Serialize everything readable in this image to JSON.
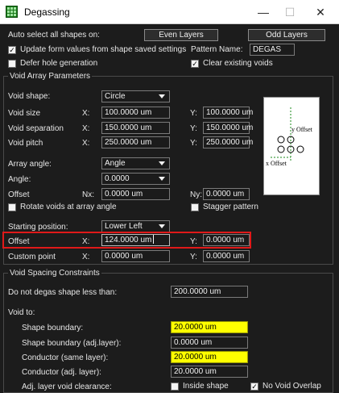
{
  "window": {
    "title": "Degassing",
    "minimize": "—",
    "maximize": "☐",
    "close": "✕"
  },
  "top": {
    "auto_select_label": "Auto select all shapes on:",
    "even_layers": "Even Layers",
    "odd_layers": "Odd Layers",
    "update_form_label": "Update form values from shape saved settings",
    "update_form_checked": true,
    "pattern_name_label": "Pattern Name:",
    "pattern_name_value": "DEGAS",
    "defer_hole_label": "Defer hole generation",
    "defer_hole_checked": false,
    "clear_voids_label": "Clear existing voids",
    "clear_voids_checked": true
  },
  "void_array": {
    "group_title": "Void Array Parameters",
    "void_shape_label": "Void shape:",
    "void_shape_value": "Circle",
    "rows": [
      {
        "label": "Void size",
        "x_label": "X:",
        "x": "100.0000 um",
        "y_label": "Y:",
        "y": "100.0000 um"
      },
      {
        "label": "Void separation",
        "x_label": "X:",
        "x": "150.0000 um",
        "y_label": "Y:",
        "y": "150.0000 um"
      },
      {
        "label": "Void pitch",
        "x_label": "X:",
        "x": "250.0000 um",
        "y_label": "Y:",
        "y": "250.0000 um"
      }
    ],
    "array_angle_label": "Array angle:",
    "array_angle_value": "Angle",
    "angle_label": "Angle:",
    "angle_value": "0.0000",
    "offset_label": "Offset",
    "nx_label": "Nx:",
    "nx_value": "0.0000 um",
    "ny_label": "Ny:",
    "ny_value": "0.0000 um",
    "rotate_label": "Rotate voids at array angle",
    "rotate_checked": false,
    "stagger_label": "Stagger pattern",
    "stagger_checked": false,
    "starting_position_label": "Starting position:",
    "starting_position_value": "Lower Left",
    "offset2_label": "Offset",
    "offset2_x_label": "X:",
    "offset2_x": "124.0000 um",
    "offset2_y_label": "Y:",
    "offset2_y": "0.0000 um",
    "custom_label": "Custom point",
    "custom_x_label": "X:",
    "custom_x": "0.0000 um",
    "custom_y_label": "Y:",
    "custom_y": "0.0000 um",
    "preview": {
      "y_offset_label": "y Offset",
      "x_offset_label": "x Offset"
    }
  },
  "spacing": {
    "group_title": "Void Spacing Constraints",
    "min_shape_label": "Do not degas shape less than:",
    "min_shape_value": "200.0000 um",
    "void_to_label": "Void to:",
    "rows": [
      {
        "label": "Shape boundary:",
        "value": "20.0000 um",
        "highlight": true
      },
      {
        "label": "Shape boundary (adj.layer):",
        "value": "0.0000 um",
        "highlight": false
      },
      {
        "label": "Conductor (same layer):",
        "value": "20.0000 um",
        "highlight": true
      },
      {
        "label": "Conductor (adj. layer):",
        "value": "20.0000 um",
        "highlight": false
      }
    ],
    "adj_clearance_label": "Adj. layer void clearance:",
    "inside_shape_label": "Inside shape",
    "inside_shape_checked": false,
    "no_overlap_label": "No Void Overlap",
    "no_overlap_checked": true
  },
  "colors": {
    "accent_highlight": "#ffff00",
    "focus_outline": "#e01919",
    "background": "#1c1c1c"
  }
}
